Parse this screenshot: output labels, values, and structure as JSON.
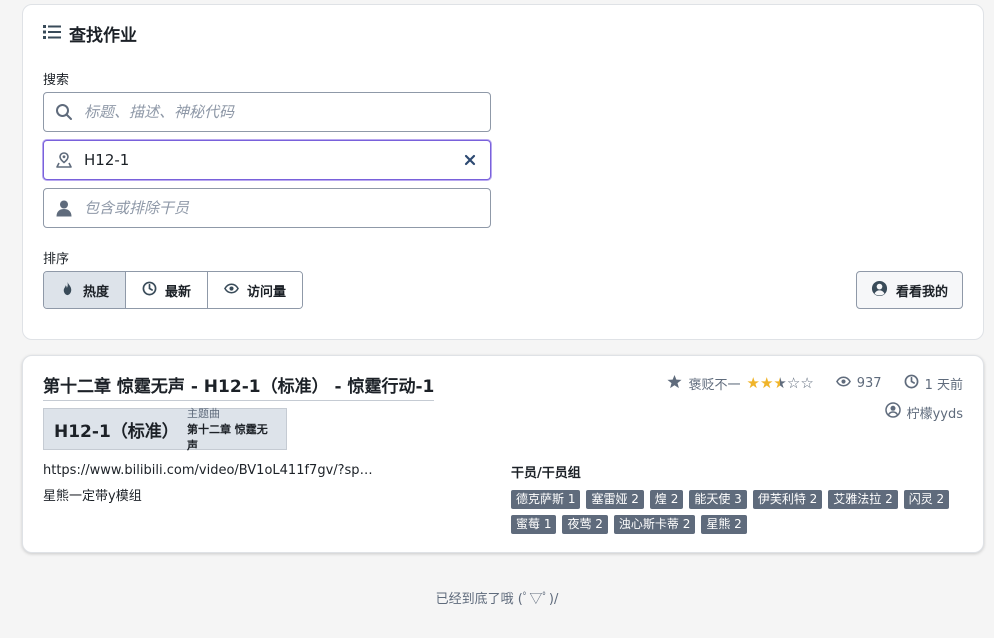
{
  "search_card": {
    "title": "查找作业",
    "search_label": "搜索",
    "keyword_placeholder": "标题、描述、神秘代码",
    "stage_value": "H12-1",
    "operator_placeholder": "包含或排除干员",
    "sort_label": "排序",
    "sort_options": [
      "热度",
      "最新",
      "访问量"
    ],
    "active_sort": "热度",
    "mine_button": "看看我的"
  },
  "result": {
    "title": "第十二章 惊霆无声 - H12-1（标准） - 惊霆行动-1",
    "stage_code": "H12-1（标准）",
    "stage_category": "主题曲",
    "stage_chapter": "第十二章 惊霆无声",
    "url": "https://www.bilibili.com/video/BV1oL411f7gv/?spm_i...",
    "description": "星熊一定带y模组",
    "rating_label": "褒贬不一",
    "rating_stars": 2.5,
    "views": "937",
    "time": "1 天前",
    "author": "柠檬yyds",
    "operators_title": "干员/干员组",
    "operators": [
      "德克萨斯 1",
      "塞雷娅 2",
      "煌 2",
      "能天使 3",
      "伊芙利特 2",
      "艾雅法拉 2",
      "闪灵 2",
      "蜜莓 1",
      "夜莺 2",
      "浊心斯卡蒂 2",
      "星熊 2"
    ]
  },
  "footer_text": "已经到底了哦 (ﾟ▽ﾟ)/",
  "colors": {
    "accent_focus": "#7961db",
    "star_filled": "#f0b429",
    "tag_bg": "#5f6b7c"
  }
}
